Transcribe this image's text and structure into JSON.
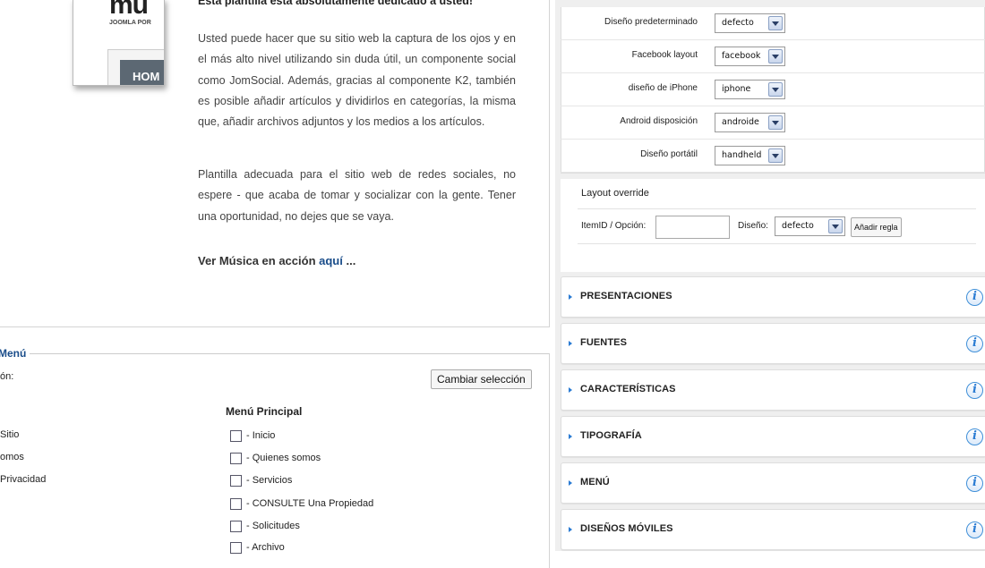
{
  "template_preview": {
    "logo_text": "mu",
    "logo_subtext": "JOOMLA POR",
    "nav_text": "HOM"
  },
  "description": {
    "heading": "Esta plantilla está absolutamente dedicado a usted!",
    "paragraph1": "Usted puede hacer que su sitio web la captura de los ojos y en el más alto nivel utilizando sin duda útil, un componente social como JomSocial. Además, gracias al componente K2, también es posible añadir artículos y dividirlos en categorías, la misma que, añadir archivos adjuntos y los medios a los artículos.",
    "paragraph2": "Plantilla adecuada para el sitio web de redes sociales, no espere - que acaba de tomar y socializar con la gente. Tener una oportunidad, no dejes que se vaya.",
    "more_prefix": "Ver Música en acción",
    "more_link": "aquí",
    "more_suffix": "..."
  },
  "menu_assignment": {
    "legend": "Menú",
    "selection_label": "ón:",
    "change_button": "Cambiar selección",
    "left_column_items": [
      "Sitio",
      "omos",
      "Privacidad"
    ],
    "menu_title": "Menú Principal",
    "menu_items": [
      "- Inicio",
      "- Quienes somos",
      "- Servicios",
      "- CONSULTE Una Propiedad",
      "- Solicitudes",
      "- Archivo"
    ]
  },
  "layout_settings": {
    "rows": [
      {
        "label": "Diseño predeterminado",
        "value": "defecto"
      },
      {
        "label": "Facebook layout",
        "value": "facebook"
      },
      {
        "label": "diseño de iPhone",
        "value": "iphone"
      },
      {
        "label": "Android disposición",
        "value": "androide"
      },
      {
        "label": "Diseño portátil",
        "value": "handheld"
      }
    ]
  },
  "layout_override": {
    "title": "Layout override",
    "itemid_label": "ItemID / Opción:",
    "itemid_value": "",
    "diseno_label": "Diseño:",
    "diseno_value": "defecto",
    "add_rule_button": "Añadir regla"
  },
  "accordion": [
    {
      "label": "PRESENTACIONES",
      "icon": "info-icon"
    },
    {
      "label": "FUENTES",
      "icon": "info-icon"
    },
    {
      "label": "CARACTERÍSTICAS",
      "icon": "info-icon"
    },
    {
      "label": "TIPOGRAFÍA",
      "icon": "info-icon"
    },
    {
      "label": "MENÚ",
      "icon": "info-icon"
    },
    {
      "label": "DISEÑOS MÓVILES",
      "icon": "info-icon"
    }
  ],
  "colors": {
    "accent_blue": "#2a7bd3",
    "link_blue": "#1a4d8a",
    "panel_gray": "#efefef"
  }
}
